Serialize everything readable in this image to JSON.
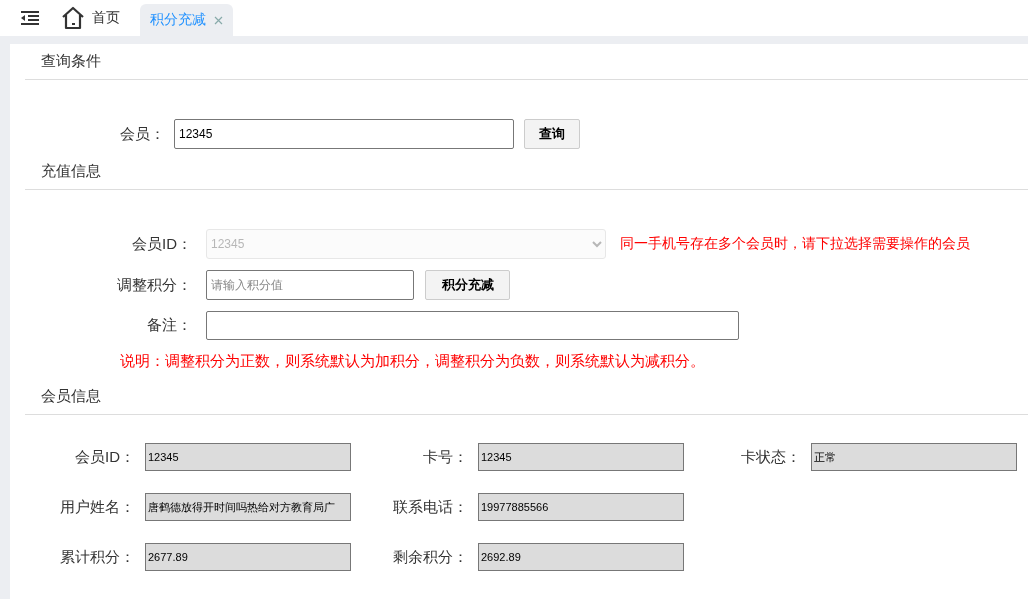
{
  "nav": {
    "home_label": "首页"
  },
  "tabs": [
    {
      "label": "积分充减",
      "selected": true
    }
  ],
  "query": {
    "title": "查询条件",
    "member_label": "会员：",
    "member_value": "12345",
    "button": "查询"
  },
  "recharge": {
    "title": "充值信息",
    "member_id": {
      "label": "会员ID：",
      "value": "12345",
      "disabled": true
    },
    "hint": "同一手机号存在多个会员时，请下拉选择需要操作的会员",
    "points": {
      "label": "调整积分：",
      "placeholder": "请输入积分值"
    },
    "button": "积分充减",
    "remark": {
      "label": "备注："
    },
    "note": "说明：调整积分为正数，则系统默认为加积分，调整积分为负数，则系统默认为减积分。"
  },
  "member_info": {
    "title": "会员信息",
    "rows": [
      {
        "fields": [
          {
            "label": "会员ID：",
            "value": "12345",
            "readonly": true
          },
          {
            "label": "卡号：",
            "value": "12345",
            "readonly": true
          },
          {
            "label": "卡状态：",
            "value": "正常",
            "readonly": true
          }
        ]
      },
      {
        "fields": [
          {
            "label": "用户姓名：",
            "value": "唐鹤德放得开时间吗热给对方教育局广",
            "readonly": true
          },
          {
            "label": "联系电话：",
            "value": "19977885566",
            "readonly": true
          }
        ]
      },
      {
        "fields": [
          {
            "label": "累计积分：",
            "value": "2677.89",
            "readonly": true
          },
          {
            "label": "剩余积分：",
            "value": "2692.89",
            "readonly": true
          }
        ]
      }
    ]
  }
}
